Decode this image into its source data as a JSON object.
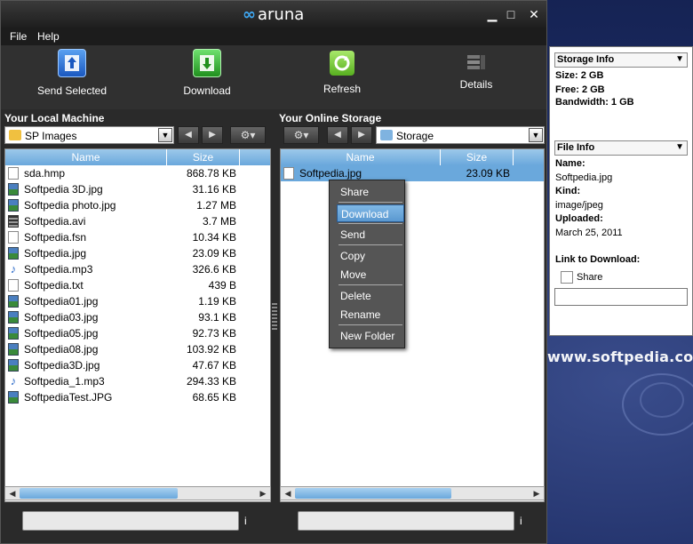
{
  "app": {
    "title": "aruna"
  },
  "menu": {
    "file": "File",
    "help": "Help"
  },
  "toolbar": {
    "send_selected": "Send Selected",
    "download": "Download",
    "refresh": "Refresh",
    "details": "Details"
  },
  "local": {
    "title": "Your Local Machine",
    "folder": "SP Images",
    "col_name": "Name",
    "col_size": "Size",
    "files": [
      {
        "name": "sda.hmp",
        "size": "868.78 KB",
        "type": "doc"
      },
      {
        "name": "Softpedia 3D.jpg",
        "size": "31.16 KB",
        "type": "img"
      },
      {
        "name": "Softpedia photo.jpg",
        "size": "1.27 MB",
        "type": "img"
      },
      {
        "name": "Softpedia.avi",
        "size": "3.7 MB",
        "type": "video"
      },
      {
        "name": "Softpedia.fsn",
        "size": "10.34 KB",
        "type": "doc"
      },
      {
        "name": "Softpedia.jpg",
        "size": "23.09 KB",
        "type": "img"
      },
      {
        "name": "Softpedia.mp3",
        "size": "326.6 KB",
        "type": "audio"
      },
      {
        "name": "Softpedia.txt",
        "size": "439 B",
        "type": "doc"
      },
      {
        "name": "Softpedia01.jpg",
        "size": "1.19 KB",
        "type": "img"
      },
      {
        "name": "Softpedia03.jpg",
        "size": "93.1 KB",
        "type": "img"
      },
      {
        "name": "Softpedia05.jpg",
        "size": "92.73 KB",
        "type": "img"
      },
      {
        "name": "Softpedia08.jpg",
        "size": "103.92 KB",
        "type": "img"
      },
      {
        "name": "Softpedia3D.jpg",
        "size": "47.67 KB",
        "type": "img"
      },
      {
        "name": "Softpedia_1.mp3",
        "size": "294.33 KB",
        "type": "audio"
      },
      {
        "name": "SoftpediaTest.JPG",
        "size": "68.65 KB",
        "type": "img"
      }
    ],
    "status_info": "i"
  },
  "online": {
    "title": "Your Online Storage",
    "folder": "Storage",
    "col_name": "Name",
    "col_size": "Size",
    "files": [
      {
        "name": "Softpedia.jpg",
        "size": "23.09 KB",
        "type": "doc"
      }
    ],
    "status_info": "i"
  },
  "context_menu": {
    "share": "Share",
    "download": "Download",
    "send": "Send",
    "copy": "Copy",
    "move": "Move",
    "delete": "Delete",
    "rename": "Rename",
    "new_folder": "New Folder"
  },
  "storage_info": {
    "title": "Storage Info",
    "size": "Size: 2 GB",
    "free": "Free: 2 GB",
    "bandwidth": "Bandwidth: 1 GB"
  },
  "file_info": {
    "title": "File Info",
    "name_label": "Name:",
    "name_value": "Softpedia.jpg",
    "kind_label": "Kind:",
    "kind_value": "image/jpeg",
    "uploaded_label": "Uploaded:",
    "uploaded_value": "March 25, 2011",
    "link_label": "Link to Download:",
    "share_label": "Share"
  },
  "desktop": {
    "watermark": "www.softpedia.com"
  },
  "colors": {
    "accent": "#6aa8dc",
    "toolbar_bg": "#303030",
    "upload_icon": "#2a6ad0",
    "download_icon": "#3cb43c",
    "refresh_icon": "#7cc83c"
  }
}
